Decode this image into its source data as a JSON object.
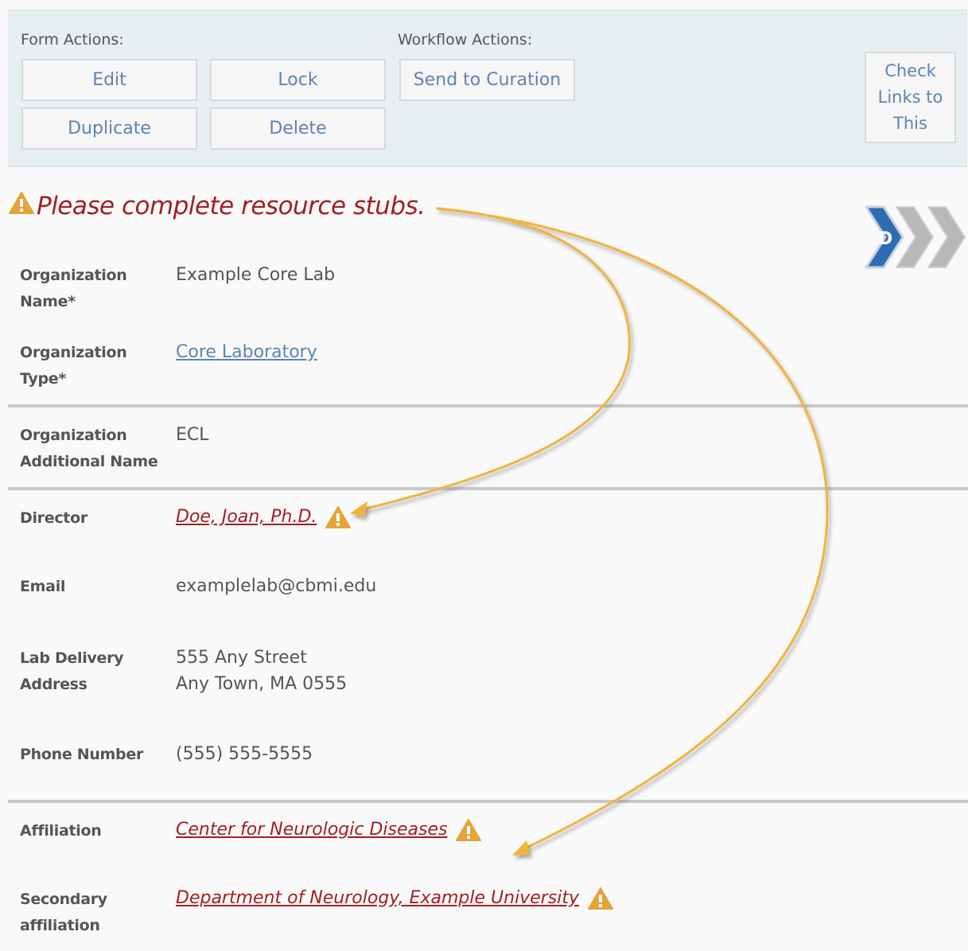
{
  "form_actions": {
    "label": "Form Actions:",
    "edit": "Edit",
    "lock": "Lock",
    "duplicate": "Duplicate",
    "delete": "Delete"
  },
  "workflow_actions": {
    "label": "Workflow Actions:",
    "send_to_curation": "Send to Curation"
  },
  "check_links": [
    "Check",
    "Links to",
    "This"
  ],
  "warning": "Please complete resource stubs.",
  "workflow_stage": "D",
  "fields": {
    "org_name": {
      "label": [
        "Organization",
        "Name*"
      ],
      "value": "Example Core Lab"
    },
    "org_type": {
      "label": [
        "Organization",
        "Type*"
      ],
      "value": "Core Laboratory"
    },
    "org_additional": {
      "label": [
        "Organization",
        "Additional Name"
      ],
      "value": "ECL"
    },
    "director": {
      "label": "Director",
      "value": "Doe, Joan, Ph.D."
    },
    "email": {
      "label": "Email",
      "value": "examplelab@cbmi.edu"
    },
    "address": {
      "label": [
        "Lab Delivery",
        "Address"
      ],
      "value": [
        "555 Any Street",
        "Any Town, MA 0555"
      ]
    },
    "phone": {
      "label": "Phone Number",
      "value": "(555) 555-5555"
    },
    "affiliation": {
      "label": "Affiliation",
      "value": "Center for Neurologic Diseases"
    },
    "secondary_affiliation": {
      "label": [
        "Secondary",
        "affiliation"
      ],
      "value": "Department of Neurology, Example University"
    }
  },
  "colors": {
    "button_text": "#5a85b3",
    "warning_text": "#a11f24",
    "warning_icon": "#e5a338",
    "arrow": "#f2b33d",
    "stage_active": "#2f6db3",
    "stage_inactive": "#b8b8b8"
  }
}
